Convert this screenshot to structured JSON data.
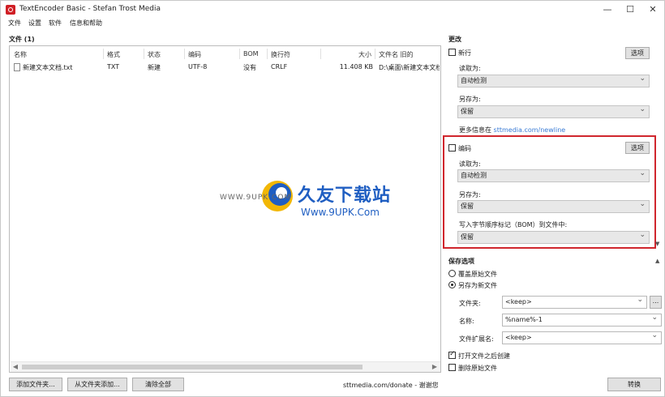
{
  "window": {
    "title": "TextEncoder Basic - Stefan Trost Media",
    "minimize": "—",
    "maximize": "☐",
    "close": "✕"
  },
  "menu": [
    "文件",
    "设置",
    "软件",
    "信息和帮助"
  ],
  "files": {
    "header": "文件 (1)",
    "columns": [
      "名称",
      "格式",
      "状态",
      "编码",
      "BOM",
      "换行符",
      "大小",
      "文件名 旧的"
    ],
    "rows": [
      {
        "name": "新建文本文档.txt",
        "format": "TXT",
        "status": "新建",
        "encoding": "UTF-8",
        "bom": "没有",
        "newline": "CRLF",
        "size": "11.408 KB",
        "path": "D:\\桌面\\新建文本文档"
      }
    ]
  },
  "changes": {
    "header": "更改",
    "newline": {
      "checkbox_label": "新行",
      "options_button": "选项",
      "read_label": "读取为:",
      "read_value": "自动检测",
      "save_label": "另存为:",
      "save_value": "保留",
      "info_prefix": "更多信息在",
      "info_link": "sttmedia.com/newline"
    },
    "encoding": {
      "checkbox_label": "编码",
      "options_button": "选项",
      "read_label": "读取为:",
      "read_value": "自动检测",
      "save_label": "另存为:",
      "save_value": "保留",
      "bom_label": "写入字节顺序标记（BOM）到文件中:",
      "bom_value": "保留"
    }
  },
  "save_options": {
    "header": "保存选项",
    "overwrite_label": "覆盖原始文件",
    "saveas_label": "另存为新文件",
    "folder_label": "文件夹:",
    "folder_value": "<keep>",
    "browse_button": "...",
    "name_label": "名称:",
    "name_value": "%name%-1",
    "ext_label": "文件扩展名:",
    "ext_value": "<keep>",
    "open_after_label": "打开文件之后创建",
    "delete_original_label": "删除原始文件"
  },
  "footer": {
    "add_files": "添加文件夹...",
    "add_from_folder": "从文件夹添加...",
    "clear_all": "清除全部",
    "donate": "sttmedia.com/donate - 谢谢您",
    "convert": "转换"
  },
  "watermark": {
    "brand": "久友下载站",
    "url": "Www.9UPK.Com",
    "url2": "WWW.9UPK.COM"
  },
  "colors": {
    "highlight": "#d0262d",
    "link": "#3a7bd5",
    "brand_icon": "#d01f25"
  }
}
